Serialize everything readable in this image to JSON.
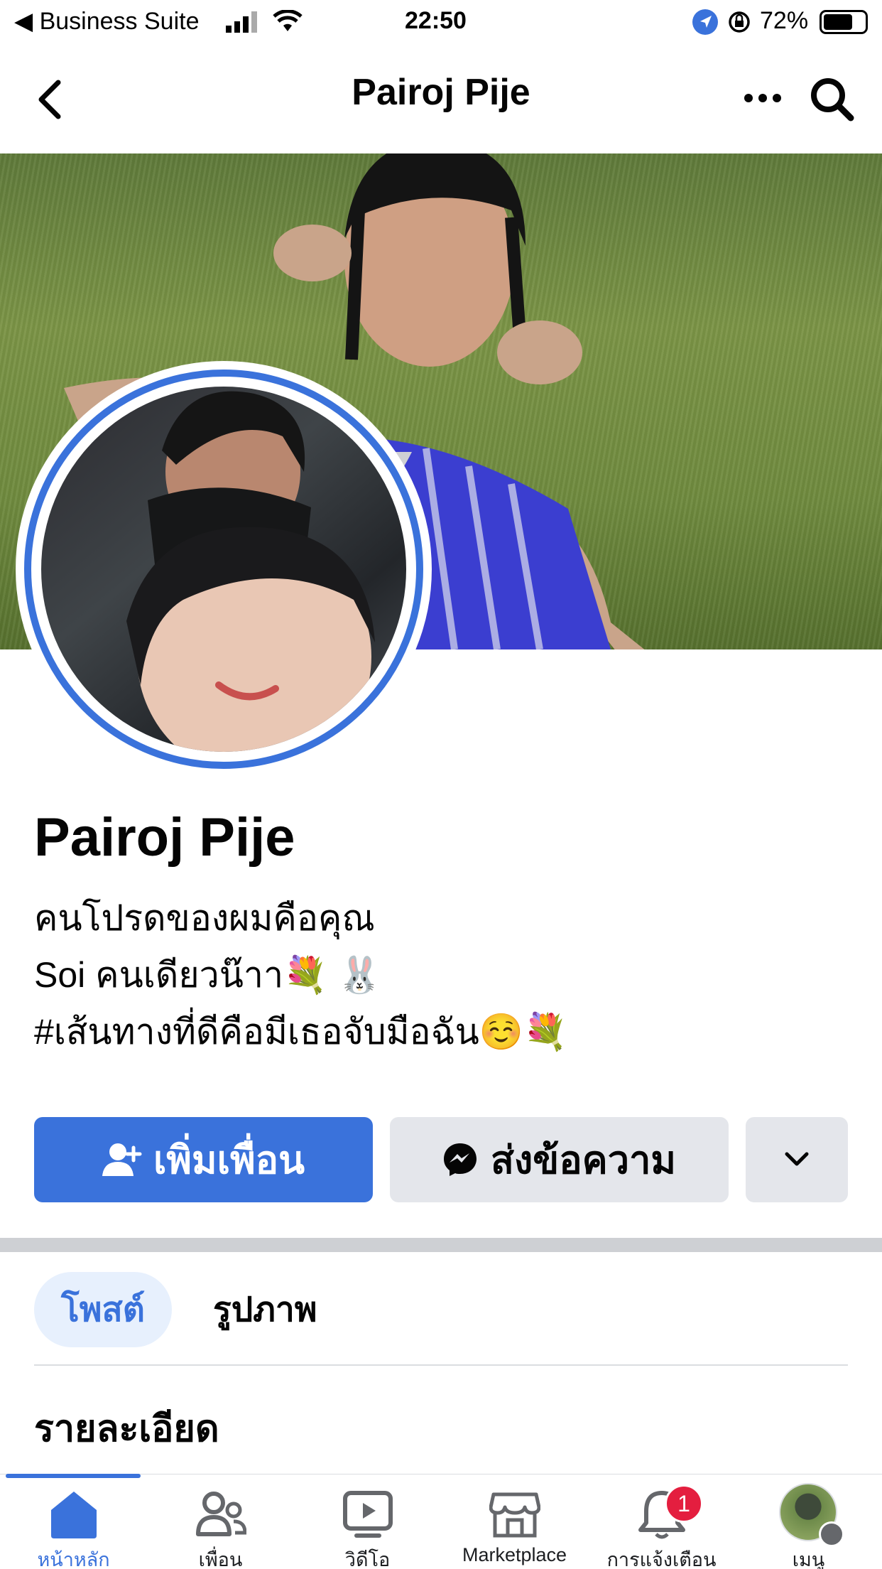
{
  "status_bar": {
    "carrier": "◀ Business Suite",
    "time": "22:50",
    "battery_percent": "72%",
    "battery_level": 0.72
  },
  "nav": {
    "title": "Pairoj Pije"
  },
  "profile": {
    "name": "Pairoj Pije",
    "bio_lines": [
      "คนโปรดของผมคือคุณ",
      "Soi คนเดียวน๊าา💐 🐰",
      "#เส้นทางที่ดีคือมีเธอจับมือฉัน☺️💐"
    ]
  },
  "actions": {
    "add_friend": "เพิ่มเพื่อน",
    "message": "ส่งข้อความ"
  },
  "tabs": {
    "posts": "โพสต์",
    "photos": "รูปภาพ"
  },
  "section": {
    "details": "รายละเอียด"
  },
  "bottom_nav": {
    "items": [
      {
        "label": "หน้าหลัก",
        "icon": "home-icon"
      },
      {
        "label": "เพื่อน",
        "icon": "friends-icon"
      },
      {
        "label": "วิดีโอ",
        "icon": "video-icon"
      },
      {
        "label": "Marketplace",
        "icon": "marketplace-icon"
      },
      {
        "label": "การแจ้งเตือน",
        "icon": "bell-icon"
      },
      {
        "label": "เมนู",
        "icon": "menu-avatar"
      }
    ],
    "notification_count": "1"
  },
  "colors": {
    "accent": "#3a72db",
    "badge": "#e41e3f",
    "secondary_button": "#e4e6eb"
  }
}
